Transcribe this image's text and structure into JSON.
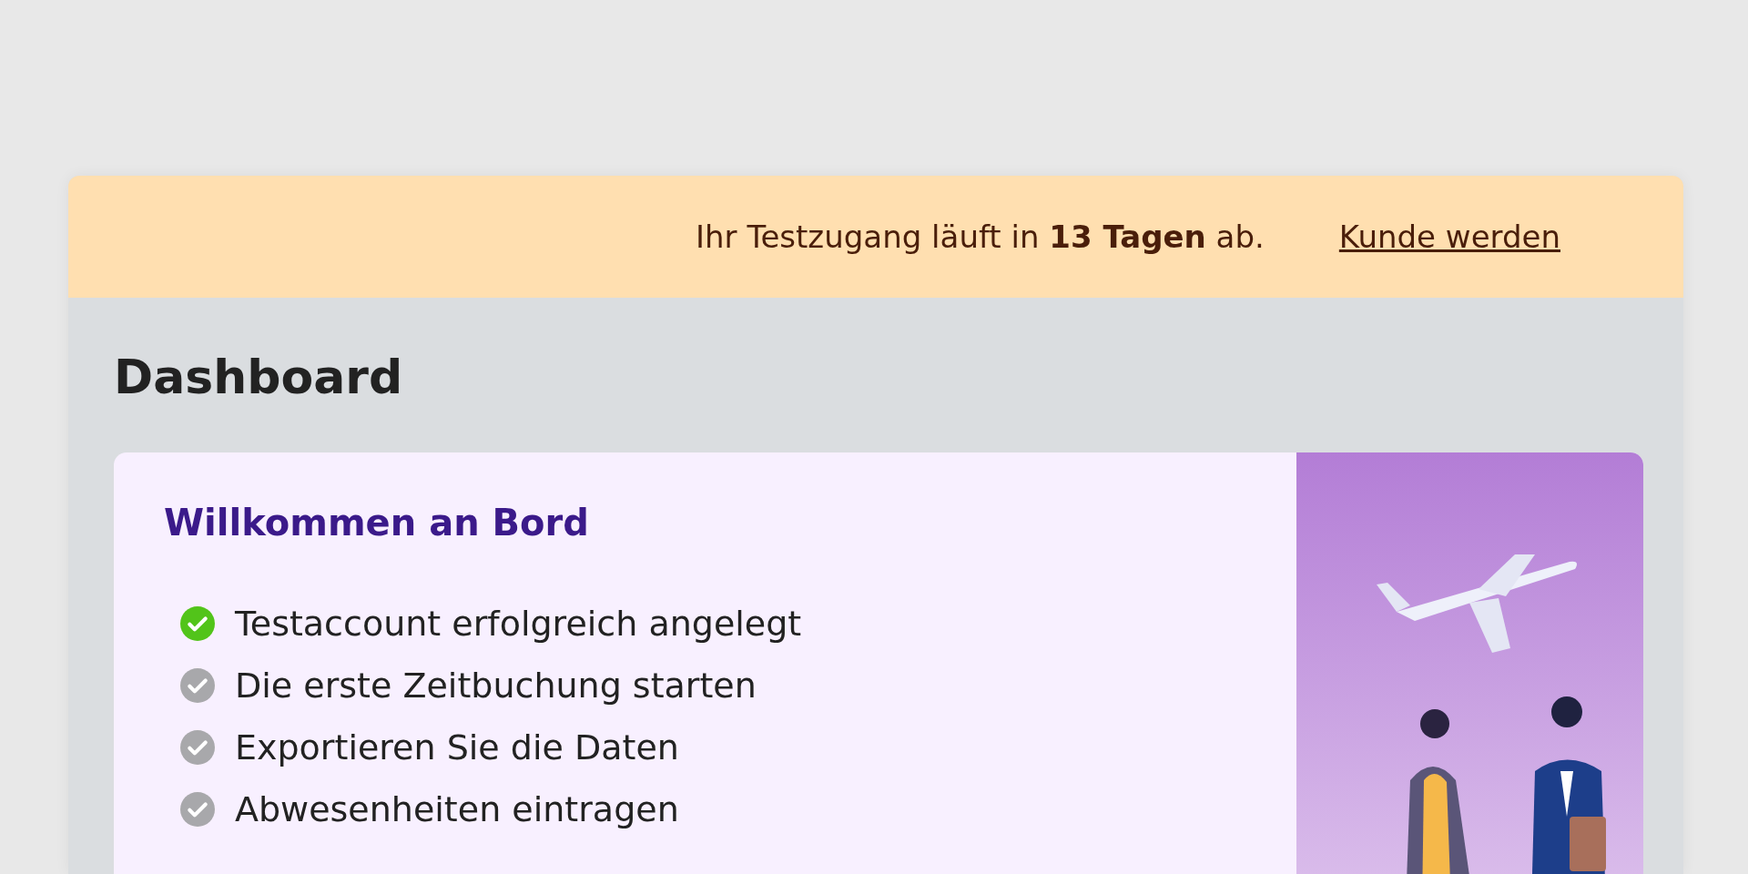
{
  "banner": {
    "message": "Ihr Testzugang läuft in **13 Tagen** ab.",
    "link": "Kunde werden"
  },
  "page_title": "Dashboard",
  "welcome_card": {
    "title": "Willkommen an Bord",
    "checklist": [
      {
        "label": "Testaccount erfolgreich angelegt",
        "checked": true
      },
      {
        "label": "Die erste Zeitbuchung starten",
        "checked": false
      },
      {
        "label": "Exportieren Sie die Daten",
        "checked": false
      },
      {
        "label": "Abwesenheiten eintragen",
        "checked": false
      }
    ]
  }
}
